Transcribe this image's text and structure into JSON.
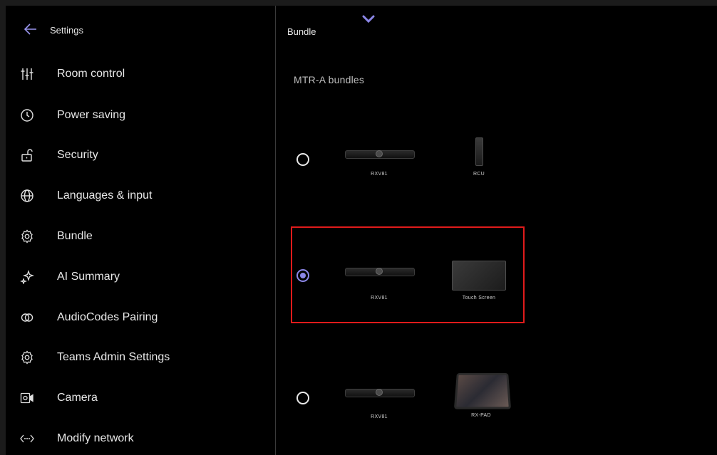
{
  "sidebar": {
    "title": "Settings",
    "items": [
      {
        "label": "Room control",
        "icon": "sliders-icon"
      },
      {
        "label": "Power saving",
        "icon": "clock-icon"
      },
      {
        "label": "Security",
        "icon": "unlock-icon"
      },
      {
        "label": "Languages & input",
        "icon": "globe-icon"
      },
      {
        "label": "Bundle",
        "icon": "gear-icon"
      },
      {
        "label": "AI Summary",
        "icon": "sparkle-icon"
      },
      {
        "label": "AudioCodes Pairing",
        "icon": "rings-icon"
      },
      {
        "label": "Teams Admin Settings",
        "icon": "gear-icon"
      },
      {
        "label": "Camera",
        "icon": "camera-icon"
      },
      {
        "label": "Modify network",
        "icon": "network-icon"
      }
    ]
  },
  "main": {
    "header": "Bundle",
    "section_title": "MTR-A bundles",
    "bundles": [
      {
        "selected": false,
        "devices": [
          "RXV81",
          "RCU"
        ]
      },
      {
        "selected": true,
        "devices": [
          "RXV81",
          "Touch Screen"
        ]
      },
      {
        "selected": false,
        "devices": [
          "RXV81",
          "RX-PAD"
        ]
      }
    ]
  },
  "colors": {
    "accent": "#8b86e6",
    "highlight": "#e01b1b",
    "background": "#000000"
  }
}
